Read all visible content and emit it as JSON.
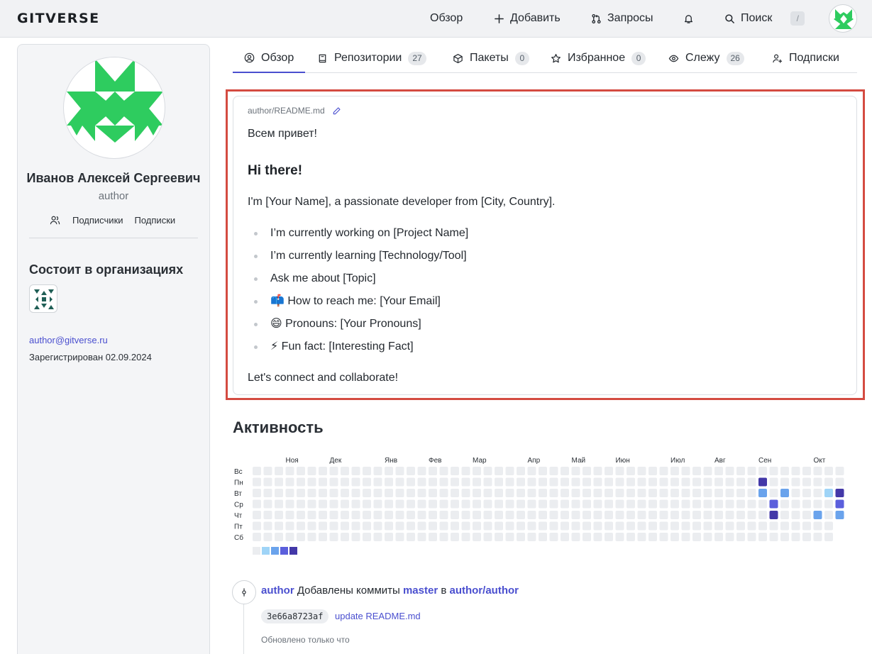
{
  "header": {
    "logo": "GITVERSE",
    "nav": {
      "overview": "Обзор",
      "add": "Добавить",
      "requests": "Запросы",
      "search": "Поиск",
      "search_shortcut": "/"
    }
  },
  "profile": {
    "full_name": "Иванов Алексей Сергеевич",
    "login": "author",
    "followers_label": "Подписчики",
    "following_label": "Подписки",
    "orgs_title": "Состоит в организациях",
    "email": "author@gitverse.ru",
    "registered": "Зарегистрирован 02.09.2024"
  },
  "tabs": [
    {
      "label": "Обзор",
      "count": ""
    },
    {
      "label": "Репозитории",
      "count": "27"
    },
    {
      "label": "Пакеты",
      "count": "0"
    },
    {
      "label": "Избранное",
      "count": "0"
    },
    {
      "label": "Слежу",
      "count": "26"
    },
    {
      "label": "Подписки",
      "count": ""
    }
  ],
  "readme": {
    "path": "author/README.md",
    "greeting": "Всем привет!",
    "heading": "Hi there!",
    "intro": "I'm [Your Name], a passionate developer from [City, Country].",
    "items": [
      "I’m currently working on [Project Name]",
      "I’m currently learning [Technology/Tool]",
      "Ask me about [Topic]",
      "📫 How to reach me: [Your Email]",
      "😄 Pronouns: [Your Pronouns]",
      "⚡ Fun fact: [Interesting Fact]"
    ],
    "outro": "Let's connect and collaborate!"
  },
  "activity": {
    "title": "Активность",
    "months": [
      "Ноя",
      "Дек",
      "Янв",
      "Фев",
      "Мар",
      "Апр",
      "Май",
      "Июн",
      "Июл",
      "Авг",
      "Сен",
      "Окт"
    ],
    "days": [
      "Вс",
      "Пн",
      "Вт",
      "Ср",
      "Чт",
      "Пт",
      "Сб"
    ],
    "levels_colors": [
      "#ebedf0",
      "#9fd4f7",
      "#6aa3ec",
      "#5b5fdc",
      "#4338a8"
    ],
    "active_cells": [
      {
        "week": 46,
        "day": 1,
        "level": 4
      },
      {
        "week": 46,
        "day": 2,
        "level": 2
      },
      {
        "week": 47,
        "day": 3,
        "level": 3
      },
      {
        "week": 47,
        "day": 4,
        "level": 4
      },
      {
        "week": 48,
        "day": 2,
        "level": 2
      },
      {
        "week": 51,
        "day": 4,
        "level": 2
      },
      {
        "week": 52,
        "day": 2,
        "level": 1
      },
      {
        "week": 53,
        "day": 2,
        "level": 4
      },
      {
        "week": 53,
        "day": 3,
        "level": 3
      },
      {
        "week": 53,
        "day": 4,
        "level": 2
      }
    ]
  },
  "feed": {
    "user": "author",
    "action": "Добавлены коммиты",
    "branch": "master",
    "preposition": "в",
    "repo": "author/author",
    "sha": "3e66a8723af",
    "commit_message": "update README.md",
    "updated": "Обновлено только что"
  },
  "colors": {
    "accent": "#4a4fcf",
    "avatar_green": "#2ecc5f",
    "highlight_border": "#d44b41"
  }
}
